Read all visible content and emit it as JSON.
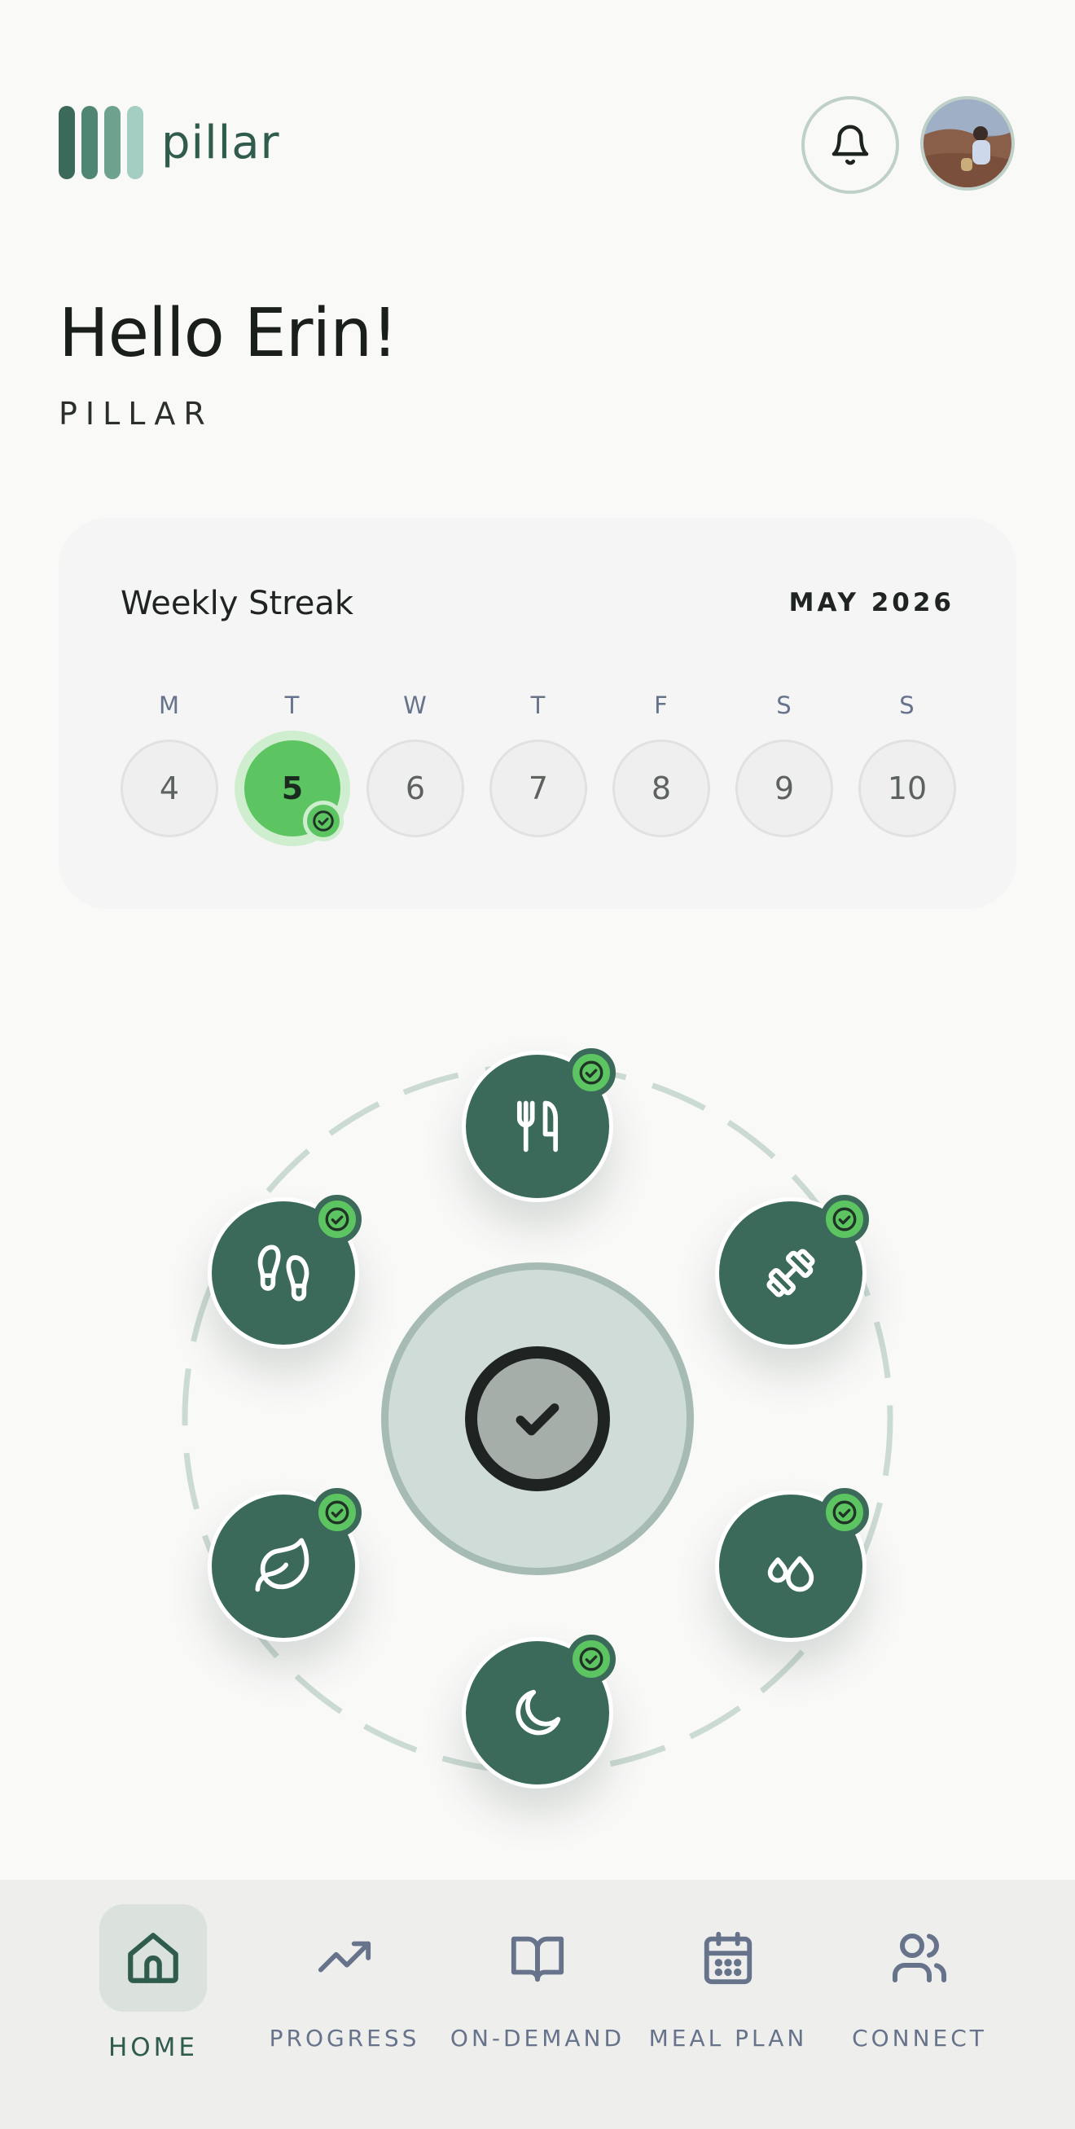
{
  "header": {
    "logo_text": "pillar",
    "logo_bar_colors": [
      "#3b6a5b",
      "#4f8573",
      "#6fa18f",
      "#a5cec2"
    ],
    "notification_icon": "bell-icon",
    "avatar_icon": "user-avatar"
  },
  "greeting": {
    "title": "Hello Erin!",
    "subtitle": "PILLAR"
  },
  "streak": {
    "title": "Weekly Streak",
    "month": "MAY 2026",
    "days": [
      {
        "letter": "M",
        "date": "4",
        "active": false
      },
      {
        "letter": "T",
        "date": "5",
        "active": true
      },
      {
        "letter": "W",
        "date": "6",
        "active": false
      },
      {
        "letter": "T",
        "date": "7",
        "active": false
      },
      {
        "letter": "F",
        "date": "8",
        "active": false
      },
      {
        "letter": "S",
        "date": "9",
        "active": false
      },
      {
        "letter": "S",
        "date": "10",
        "active": false
      }
    ]
  },
  "pillars": [
    {
      "name": "nutrition",
      "icon": "fork-knife-icon",
      "completed": true
    },
    {
      "name": "fitness",
      "icon": "dumbbell-icon",
      "completed": true
    },
    {
      "name": "hydration",
      "icon": "water-drops-icon",
      "completed": true
    },
    {
      "name": "sleep",
      "icon": "moon-icon",
      "completed": true
    },
    {
      "name": "mindfulness",
      "icon": "leaf-icon",
      "completed": true
    },
    {
      "name": "steps",
      "icon": "footsteps-icon",
      "completed": true
    }
  ],
  "center": {
    "icon": "check-circle-icon"
  },
  "colors": {
    "accent": "#3b6a5b",
    "success": "#5cc460",
    "muted": "#66738b",
    "background": "#f9f9f8"
  },
  "nav": {
    "items": [
      {
        "label": "HOME",
        "icon": "home-icon",
        "active": true
      },
      {
        "label": "PROGRESS",
        "icon": "trend-up-icon",
        "active": false
      },
      {
        "label": "ON-DEMAND",
        "icon": "book-open-icon",
        "active": false
      },
      {
        "label": "MEAL PLAN",
        "icon": "calendar-icon",
        "active": false
      },
      {
        "label": "CONNECT",
        "icon": "users-icon",
        "active": false
      }
    ]
  }
}
